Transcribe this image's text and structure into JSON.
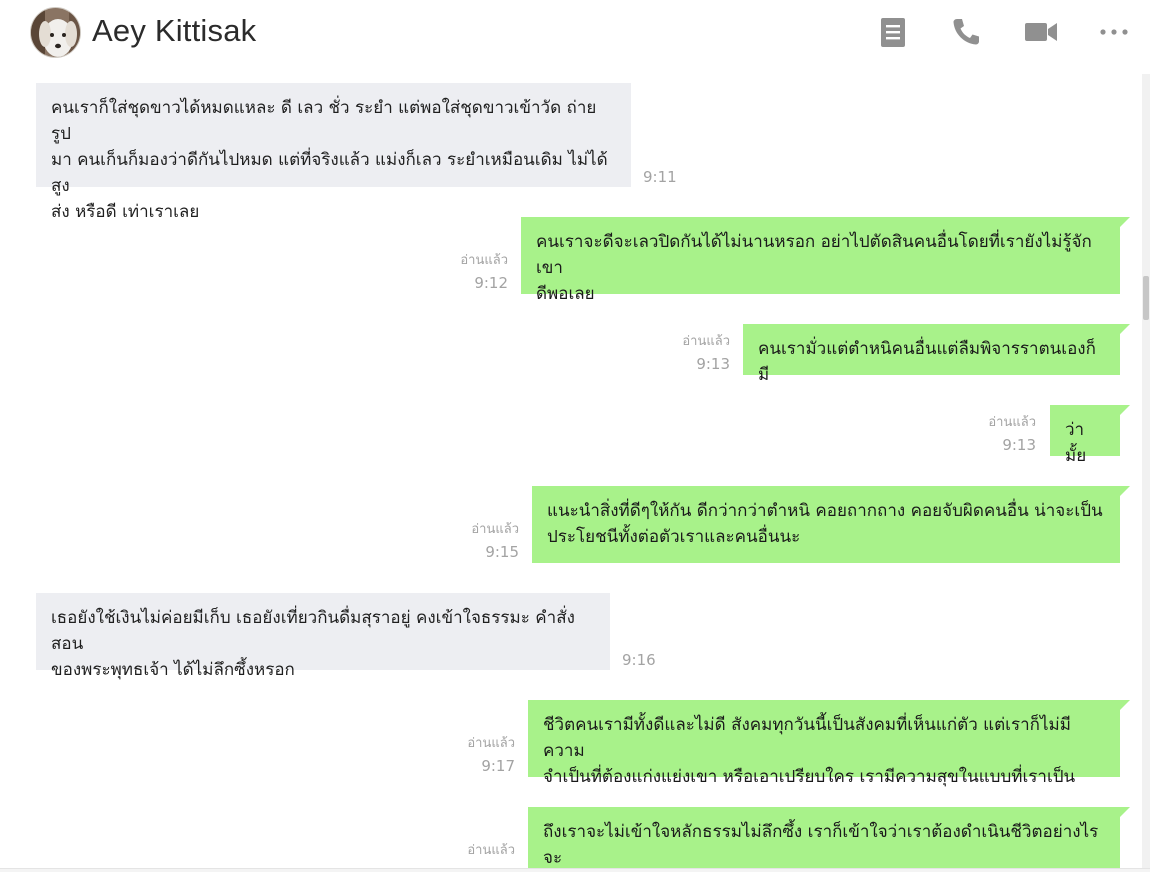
{
  "header": {
    "contact_name": "Aey Kittisak",
    "avatar_icon": "dog-avatar",
    "icons": [
      "note-icon",
      "phone-icon",
      "video-icon",
      "more-icon"
    ]
  },
  "messages": [
    {
      "direction": "in",
      "text": "คนเราก็ใส่ชุดขาวได้หมดแหละ ดี เลว ชั่ว ระยำ แต่พอใส่ชุดขาวเข้าวัด ถ่ายรูป\nมา คนเก็นก็มองว่าดีกันไปหมด แต่ที่จริงแล้ว แม่งก็เลว ระยำเหมือนเดิม ไม่ได้สูง\nส่ง หรือดี เท่าเราเลย",
      "time": "9:11"
    },
    {
      "direction": "out",
      "text": "คนเราจะดีจะเลวปิดกันได้ไม่นานหรอก อย่าไปตัดสินคนอื่นโดยที่เรายังไม่รู้จักเขา\nดีพอเลย",
      "read": "อ่านแล้ว",
      "time": "9:12"
    },
    {
      "direction": "out",
      "text": "คนเรามั่วแต่ตำหนิคนอื่นแต่ลืมพิจารราตนเองก็มี",
      "read": "อ่านแล้ว",
      "time": "9:13"
    },
    {
      "direction": "out",
      "text": "ว่ามั้ย",
      "read": "อ่านแล้ว",
      "time": "9:13"
    },
    {
      "direction": "out",
      "text": "แนะนำสิ่งที่ดีๆให้กัน ดีกว่ากว่าตำหนิ คอยถากถาง คอยจับผิดคนอื่น น่าจะเป็น\nประโยชนีทั้งต่อตัวเราและคนอื่นนะ",
      "read": "อ่านแล้ว",
      "time": "9:15"
    },
    {
      "direction": "in",
      "text": "เธอยังใช้เงินไม่ค่อยมีเก็บ เธอยังเที่ยวกินดื่มสุราอยู่ คงเข้าใจธรรมะ คำสั่งสอน\nของพระพุทธเจ้า ได้ไม่ลึกซึ้งหรอก",
      "time": "9:16"
    },
    {
      "direction": "out",
      "text": "ชีวิตคนเรามีทั้งดีและไม่ดี สังคมทุกวันนี้เป็นสังคมที่เห็นแก่ตัว แต่เราก็ไม่มีความ\nจำเป็นที่ต้องแก่งแย่งเขา หรือเอาเปรียบใคร เรามีความสุขในแบบที่เราเป็น",
      "read": "อ่านแล้ว",
      "time": "9:17"
    },
    {
      "direction": "out",
      "text": "ถึงเราจะไม่เข้าใจหลักธรรมไม่ลึกซึ้ง เราก็เข้าใจว่าเราต้องดำเนินชีวิตอย่างไรจะ\nได้ไม่ทุกข์",
      "read": "อ่านแล้ว",
      "time": ""
    }
  ]
}
